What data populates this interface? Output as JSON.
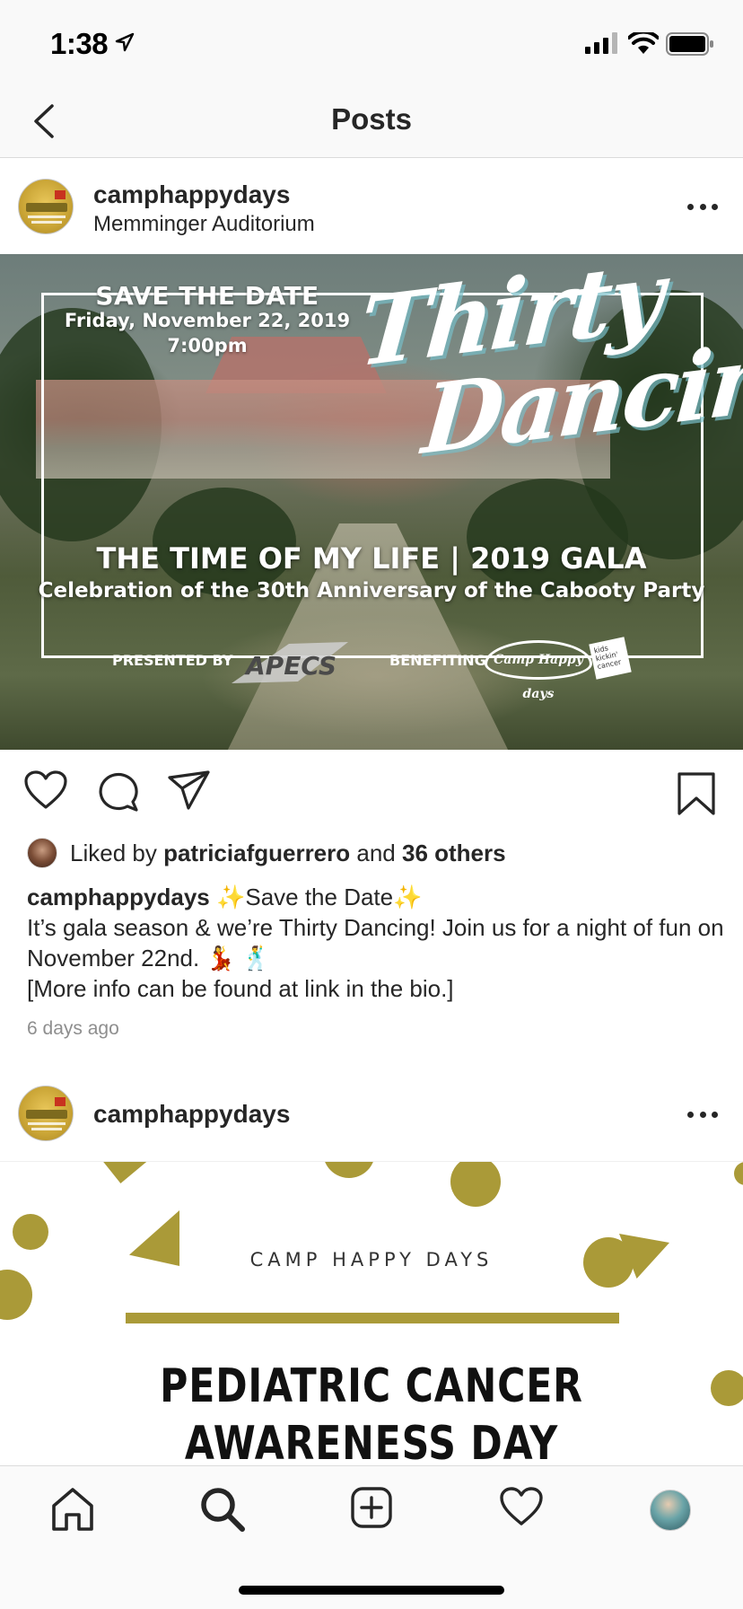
{
  "status_bar": {
    "time": "1:38"
  },
  "nav": {
    "title": "Posts"
  },
  "post1": {
    "username": "camphappydays",
    "location": "Memminger Auditorium",
    "image": {
      "save_the_date": "SAVE THE DATE",
      "date": "Friday, November 22, 2019",
      "time": "7:00pm",
      "title_line1": "Thirty",
      "title_line2": "Dancing",
      "gala_line": "THE TIME OF MY LIFE  |  2019 GALA",
      "celebration_line": "Celebration of the 30th Anniversary of the Cabooty Party",
      "presented_by": "PRESENTED BY",
      "presenter_logo": "APECS",
      "benefiting": "BENEFITING",
      "beneficiary_logo": "Camp Happy days",
      "second_logo": "kids kickin' cancer"
    },
    "liked_by_prefix": "Liked by ",
    "liked_by_user": "patriciafguerrero",
    "liked_by_and": " and ",
    "liked_by_others": "36 others",
    "caption_user": "camphappydays",
    "caption_line1": " ✨Save the Date✨",
    "caption_line2": "It’s gala season & we’re Thirty Dancing! Join us for a night of fun on November 22nd. 💃 🕺",
    "caption_line3": "[More info can be found at link in the bio.]",
    "timestamp": "6 days ago"
  },
  "post2": {
    "username": "camphappydays",
    "image": {
      "brand": "CAMP HAPPY DAYS",
      "headline_line1": "PEDIATRIC CANCER",
      "headline_line2": "AWARENESS DAY"
    }
  },
  "colors": {
    "gold": "#aa9a38",
    "text": "#262626",
    "muted": "#8e8e8e"
  },
  "icons": [
    "location-arrow-icon",
    "signal-icon",
    "wifi-icon",
    "battery-icon",
    "back-chevron-icon",
    "more-icon",
    "heart-icon",
    "comment-icon",
    "share-icon",
    "bookmark-icon",
    "home-icon",
    "search-icon",
    "add-post-icon",
    "activity-heart-icon",
    "profile-avatar"
  ]
}
